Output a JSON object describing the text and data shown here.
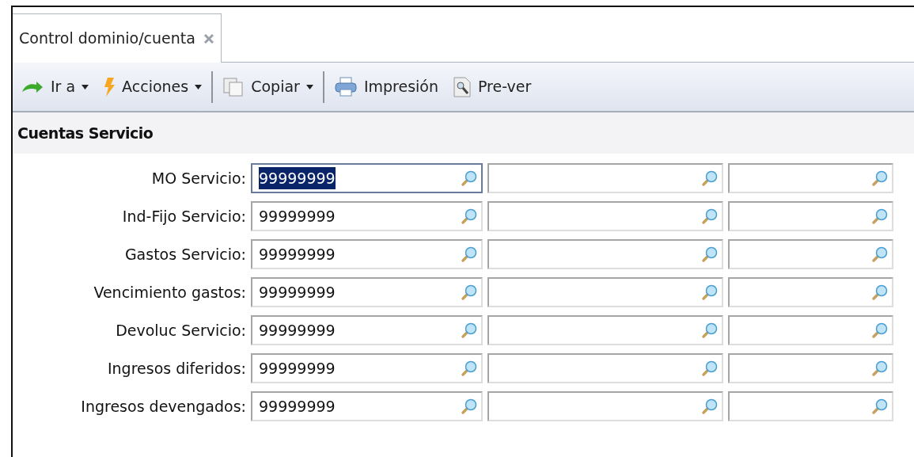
{
  "tabs": [
    {
      "label": "Control dominio/cuenta",
      "selected": true
    }
  ],
  "toolbar": [
    {
      "kind": "dropdown",
      "label": "Ir a"
    },
    {
      "kind": "dropdown",
      "label": "Acciones"
    },
    {
      "kind": "separator"
    },
    {
      "kind": "dropdown",
      "label": "Copiar"
    },
    {
      "kind": "separator"
    },
    {
      "kind": "button",
      "label": "Impresión"
    },
    {
      "kind": "button",
      "label": "Pre-ver"
    }
  ],
  "section": {
    "title": "Cuentas Servicio"
  },
  "rows": [
    {
      "label": "MO Servicio:",
      "fields": [
        {
          "value": "99999999",
          "selected": true
        },
        {
          "selected": false
        },
        {
          "selected": false
        }
      ]
    },
    {
      "label": "Ind-Fijo Servicio:",
      "fields": [
        {
          "value": "99999999",
          "selected": false
        },
        {
          "selected": false
        },
        {
          "selected": false
        }
      ]
    },
    {
      "label": "Gastos Servicio:",
      "fields": [
        {
          "value": "99999999",
          "selected": false
        },
        {
          "selected": false
        },
        {
          "selected": false
        }
      ]
    },
    {
      "label": "Vencimiento gastos:",
      "fields": [
        {
          "value": "99999999",
          "selected": false
        },
        {
          "selected": false
        },
        {
          "selected": false
        }
      ]
    },
    {
      "label": "Devoluc Servicio:",
      "fields": [
        {
          "value": "99999999",
          "selected": false
        },
        {
          "selected": false
        },
        {
          "selected": false
        }
      ]
    },
    {
      "label": "Ingresos diferidos:",
      "fields": [
        {
          "value": "99999999",
          "selected": false
        },
        {
          "selected": false
        },
        {
          "selected": false
        }
      ]
    },
    {
      "label": "Ingresos devengados:",
      "fields": [
        {
          "value": "99999999",
          "selected": false
        },
        {
          "selected": false
        },
        {
          "selected": false
        }
      ]
    }
  ]
}
